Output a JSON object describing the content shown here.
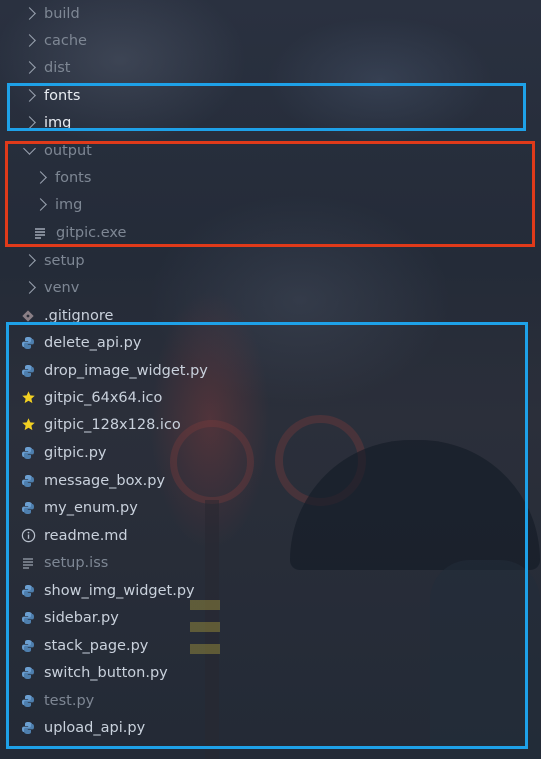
{
  "explorer": {
    "items": [
      {
        "label": "build",
        "kind": "folder",
        "state": "collapsed"
      },
      {
        "label": "cache",
        "kind": "folder",
        "state": "collapsed"
      },
      {
        "label": "dist",
        "kind": "folder",
        "state": "collapsed"
      },
      {
        "label": "fonts",
        "kind": "folder",
        "state": "collapsed"
      },
      {
        "label": "img",
        "kind": "folder",
        "state": "collapsed"
      },
      {
        "label": "output",
        "kind": "folder",
        "state": "expanded"
      },
      {
        "label": "fonts",
        "kind": "folder",
        "state": "collapsed"
      },
      {
        "label": "img",
        "kind": "folder",
        "state": "collapsed"
      },
      {
        "label": "gitpic.exe",
        "kind": "file",
        "icon": "lines-icon"
      },
      {
        "label": "setup",
        "kind": "folder",
        "state": "collapsed"
      },
      {
        "label": "venv",
        "kind": "folder",
        "state": "collapsed"
      },
      {
        "label": ".gitignore",
        "kind": "file",
        "icon": "git-diamond-icon"
      },
      {
        "label": "delete_api.py",
        "kind": "file",
        "icon": "python-icon"
      },
      {
        "label": "drop_image_widget.py",
        "kind": "file",
        "icon": "python-icon"
      },
      {
        "label": "gitpic_64x64.ico",
        "kind": "file",
        "icon": "star-icon"
      },
      {
        "label": "gitpic_128x128.ico",
        "kind": "file",
        "icon": "star-icon"
      },
      {
        "label": "gitpic.py",
        "kind": "file",
        "icon": "python-icon"
      },
      {
        "label": "message_box.py",
        "kind": "file",
        "icon": "python-icon"
      },
      {
        "label": "my_enum.py",
        "kind": "file",
        "icon": "python-icon"
      },
      {
        "label": "readme.md",
        "kind": "file",
        "icon": "info-icon"
      },
      {
        "label": "setup.iss",
        "kind": "file",
        "icon": "lines-icon"
      },
      {
        "label": "show_img_widget.py",
        "kind": "file",
        "icon": "python-icon"
      },
      {
        "label": "sidebar.py",
        "kind": "file",
        "icon": "python-icon"
      },
      {
        "label": "stack_page.py",
        "kind": "file",
        "icon": "python-icon"
      },
      {
        "label": "switch_button.py",
        "kind": "file",
        "icon": "python-icon"
      },
      {
        "label": "test.py",
        "kind": "file",
        "icon": "python-icon"
      },
      {
        "label": "upload_api.py",
        "kind": "file",
        "icon": "python-icon"
      }
    ]
  },
  "colors": {
    "highlight_blue": "#1ea1e8",
    "highlight_red": "#e03a1a",
    "python_icon": "#5b8fbf",
    "star_icon": "#f2d022"
  }
}
